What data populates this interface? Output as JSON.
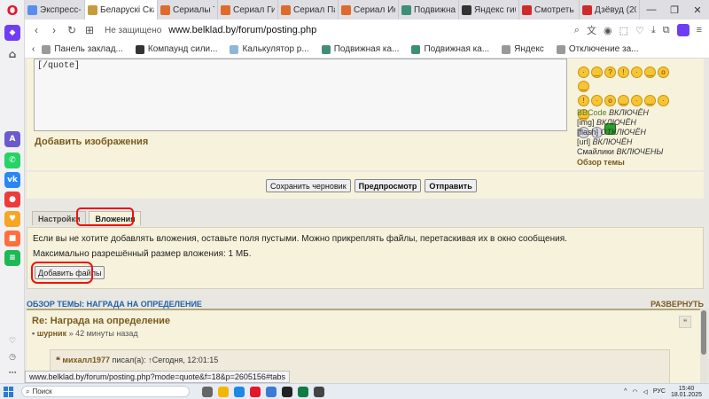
{
  "browser": {
    "tabs": [
      {
        "label": "Экспресс-па",
        "color": "#5b8def"
      },
      {
        "label": "Беларускі Скарбашч",
        "color": "#c79a3c",
        "active": true
      },
      {
        "label": "Сериалы ТУ",
        "color": "#e06a2b"
      },
      {
        "label": "Сериал Гибе",
        "color": "#e06a2b"
      },
      {
        "label": "Сериал Пар",
        "color": "#e06a2b"
      },
      {
        "label": "Сериал Исп",
        "color": "#e06a2b"
      },
      {
        "label": "Подвижная",
        "color": "#3f8e7a"
      },
      {
        "label": "Яндекс гибр",
        "color": "#333333"
      },
      {
        "label": "Смотреть ф",
        "color": "#d12a2a"
      },
      {
        "label": "Дзёвуд (200",
        "color": "#d12a2a"
      }
    ],
    "security_label": "Не защищено",
    "url": "www.belklad.by/forum/posting.php",
    "bookmarks": [
      {
        "label": "Панель заклад...",
        "color": "#999999"
      },
      {
        "label": "Компаунд сили...",
        "color": "#333333"
      },
      {
        "label": "Калькулятор р...",
        "color": "#8fb6d9"
      },
      {
        "label": "Подвижная ка...",
        "color": "#3f8e7a"
      },
      {
        "label": "Подвижная ка...",
        "color": "#3f8e7a"
      },
      {
        "label": "Яндекс",
        "color": "#999999"
      },
      {
        "label": "Отключение за...",
        "color": "#999999"
      }
    ],
    "status_url": "www.belklad.by/forum/posting.php?mode=quote&f=18&p=2605156#tabs"
  },
  "editor": {
    "textarea_value": "[/quote]",
    "add_images_label": "Добавить изображения",
    "bbcode": [
      {
        "key": "BBCode",
        "value": "ВКЛЮЧЁН"
      },
      {
        "key": "[img]",
        "value": "ВКЛЮЧЁН"
      },
      {
        "key": "[flash]",
        "value": "ОТКЛЮЧЁН"
      },
      {
        "key": "[url]",
        "value": "ВКЛЮЧЁН"
      },
      {
        "key": "Смайлики",
        "value": "ВКЛЮЧЕНЫ"
      }
    ],
    "review_topic_link": "Обзор темы"
  },
  "buttons": {
    "save_draft": "Сохранить черновик",
    "preview": "Предпросмотр",
    "submit": "Отправить"
  },
  "form_tabs": {
    "settings": "Настройки",
    "attachments": "Вложения"
  },
  "attachments": {
    "info": "Если вы не хотите добавлять вложения, оставьте поля пустыми. Можно прикреплять файлы, перетаскивая их в окно сообщения.",
    "max_size": "Максимально разрешённый размер вложения: 1 МБ.",
    "add_files": "Добавить файлы"
  },
  "topic_review": {
    "heading": "ОБЗОР ТЕМЫ: НАГРАДА НА ОПРЕДЕЛЕНИЕ",
    "expand": "РАЗВЕРНУТЬ",
    "post_title": "Re: Награда на определение",
    "post_author": "шурник",
    "post_time": "» 42 минуты назад",
    "quote_author": "михалл1977",
    "quote_wrote": "писал(а):",
    "quote_time": "↑Сегодня, 12:01:15"
  },
  "taskbar": {
    "search_placeholder": "Поиск",
    "lang": "РУС",
    "time": "15:40",
    "date": "18.01.2025"
  }
}
